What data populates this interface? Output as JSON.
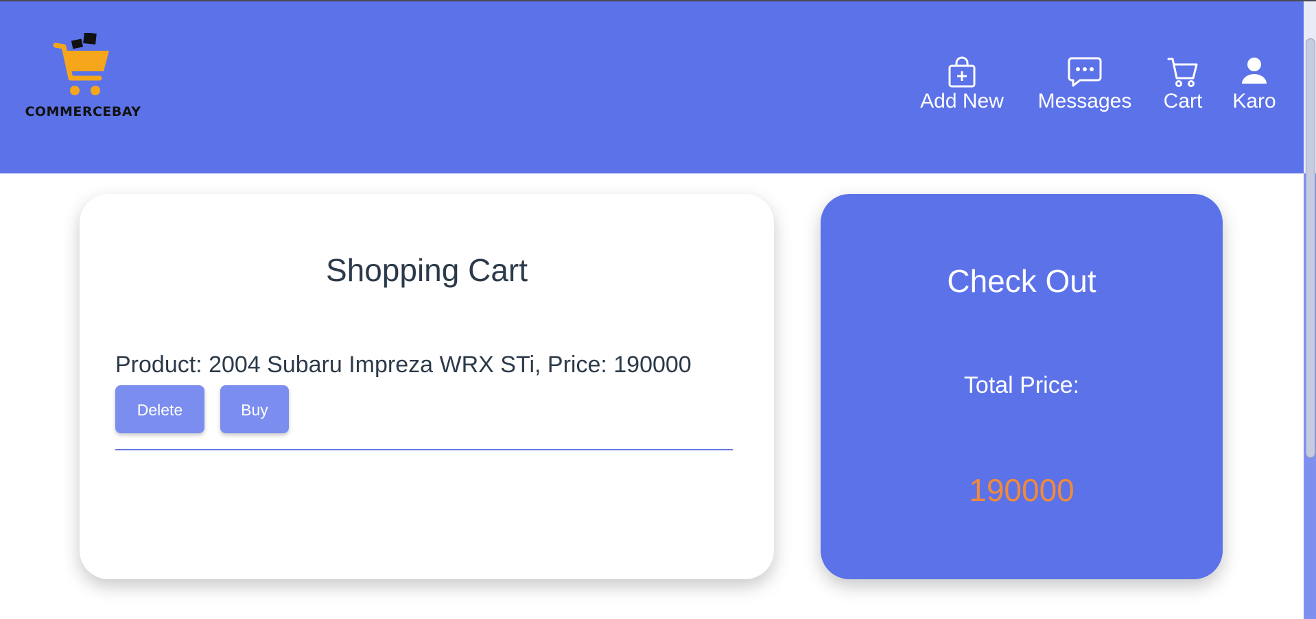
{
  "brand": {
    "logo_text": "COMMERCEBAY"
  },
  "nav": {
    "items": [
      {
        "label": "Add New",
        "icon": "shopping-bag-plus-icon"
      },
      {
        "label": "Messages",
        "icon": "chat-bubble-icon"
      },
      {
        "label": "Cart",
        "icon": "cart-icon"
      },
      {
        "label": "Karo",
        "icon": "user-icon"
      }
    ]
  },
  "cart": {
    "title": "Shopping Cart",
    "items": [
      {
        "text": "Product: 2004 Subaru Impreza WRX STi, Price: 190000",
        "delete_label": "Delete",
        "buy_label": "Buy"
      }
    ]
  },
  "checkout": {
    "title": "Check Out",
    "total_label": "Total Price:",
    "total_value": "190000"
  },
  "colors": {
    "primary": "#5c72e8",
    "button": "#7b8def",
    "price": "#f28a3a",
    "text": "#2c3a4a",
    "logo_cart": "#f5a61a"
  }
}
